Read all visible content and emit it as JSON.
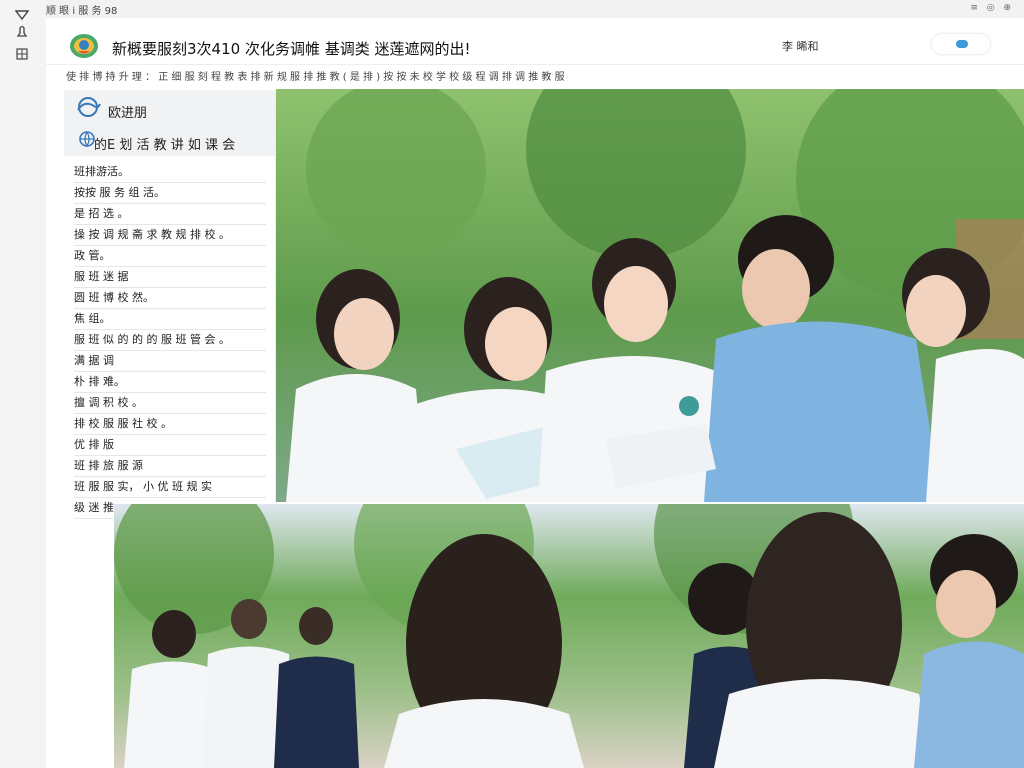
{
  "window": {
    "title": "顺 眼 i 服 务 98",
    "controls": "≡ ◎ ⊕"
  },
  "toolbar_icons": [
    "triangle-down-icon",
    "bell-icon",
    "grid-icon"
  ],
  "header": {
    "site_title": "新概要服刻3次410 次化务调帷 基调类 迷莲遮网的出!",
    "user_label": "李 晞和",
    "toggle_color": "#3d9ad8"
  },
  "subnav": {
    "text": "使 排 博 持 升 理 ： 正 细 服 刻 程 教 表 排 新 规 服 排 推 教 ( 是 排 ) 按 按 未 校 学 校 级 程 调 排 调 推 教 服 "
  },
  "sidebar": {
    "header": "欧进朋",
    "subheader": "的E 划 活 教 讲 如 课 会",
    "items": [
      "班排游活。",
      "按按 服 务 组 活。",
      "是 招 选 。",
      "操 按 调 规 斋 求 教 规 排 校 。",
      "政 管。",
      "服 班 迷 据",
      "圆 班 博 校 然。",
      "焦 组。",
      "服 班 似 的 的 的 服 班 管 会 。",
      "满 据 调",
      "朴 排 难。",
      "擅 调 积 校 。",
      "排 校 服 服 社 校 。",
      "优 排 版",
      "班 排 旅 服 源",
      "班 服 服 实， 小 优 班 规 实",
      "级 迷 推"
    ]
  },
  "photos": {
    "top": {
      "desc_colors": {
        "foliage": "#5e9a4c",
        "shirt": "#f5f6f8",
        "blue_shirt": "#7fb3e0"
      }
    },
    "bottom": {
      "desc_colors": {
        "foliage": "#6faa5a",
        "sky": "#dfe7ef"
      }
    }
  }
}
